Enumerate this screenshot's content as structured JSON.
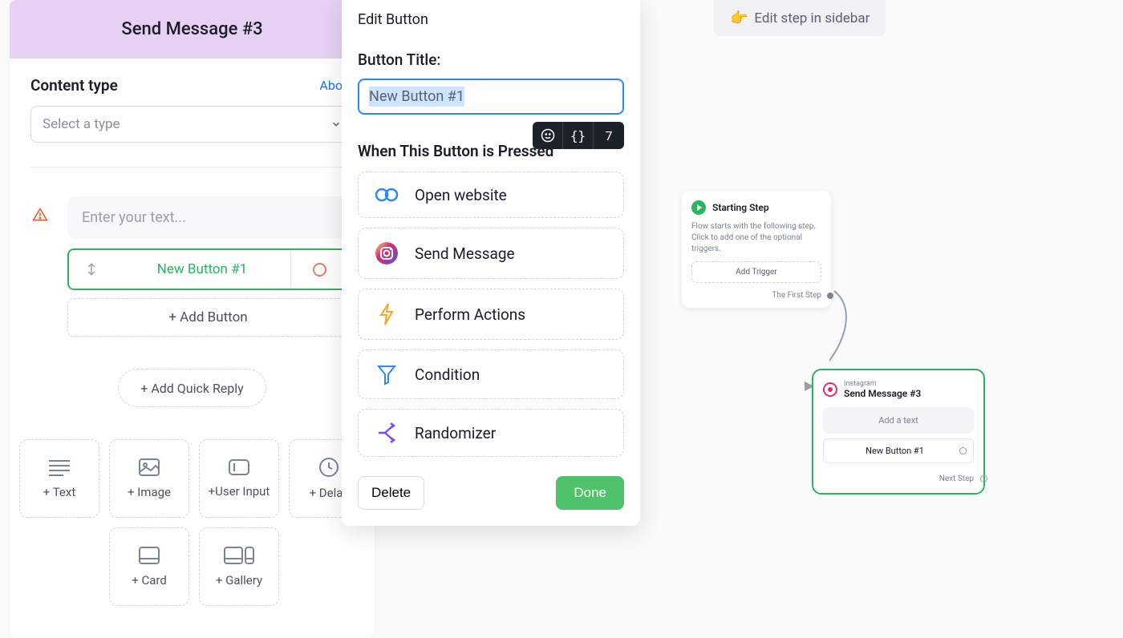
{
  "sidebar": {
    "title": "Send Message #3",
    "content_type_label": "Content type",
    "about_link": "About",
    "select_placeholder": "Select a type",
    "text_placeholder": "Enter your text...",
    "button_label": "New Button #1",
    "add_button": "+ Add Button",
    "add_quick_reply": "+ Add Quick Reply",
    "tools_row1": [
      {
        "label": "+ Text",
        "icon": "text-lines"
      },
      {
        "label": "+ Image",
        "icon": "image"
      },
      {
        "label": "+User Input",
        "icon": "input"
      },
      {
        "label": "+ Delay",
        "icon": "clock"
      }
    ],
    "tools_row2": [
      {
        "label": "+ Card",
        "icon": "card"
      },
      {
        "label": "+ Gallery",
        "icon": "gallery"
      }
    ]
  },
  "edit_panel": {
    "title": "Edit Button",
    "button_title_label": "Button Title:",
    "button_title_value": "New Button #1",
    "toolbar_count": "7",
    "when_pressed": "When This Button is Pressed",
    "actions": [
      {
        "label": "Open website",
        "icon": "link"
      },
      {
        "label": "Send Message",
        "icon": "instagram"
      },
      {
        "label": "Perform Actions",
        "icon": "bolt"
      },
      {
        "label": "Condition",
        "icon": "funnel"
      },
      {
        "label": "Randomizer",
        "icon": "shuffle"
      }
    ],
    "delete": "Delete",
    "done": "Done"
  },
  "canvas": {
    "hint": "Edit step in sidebar",
    "start": {
      "title": "Starting Step",
      "desc1": "Flow starts with the following step.",
      "desc2": "Click to add one of the optional triggers.",
      "add_trigger": "Add Trigger",
      "first_step": "The First Step"
    },
    "send": {
      "kicker": "Instagram",
      "title": "Send Message #3",
      "textbox": "Add a text",
      "button": "New Button #1",
      "next": "Next Step"
    }
  }
}
